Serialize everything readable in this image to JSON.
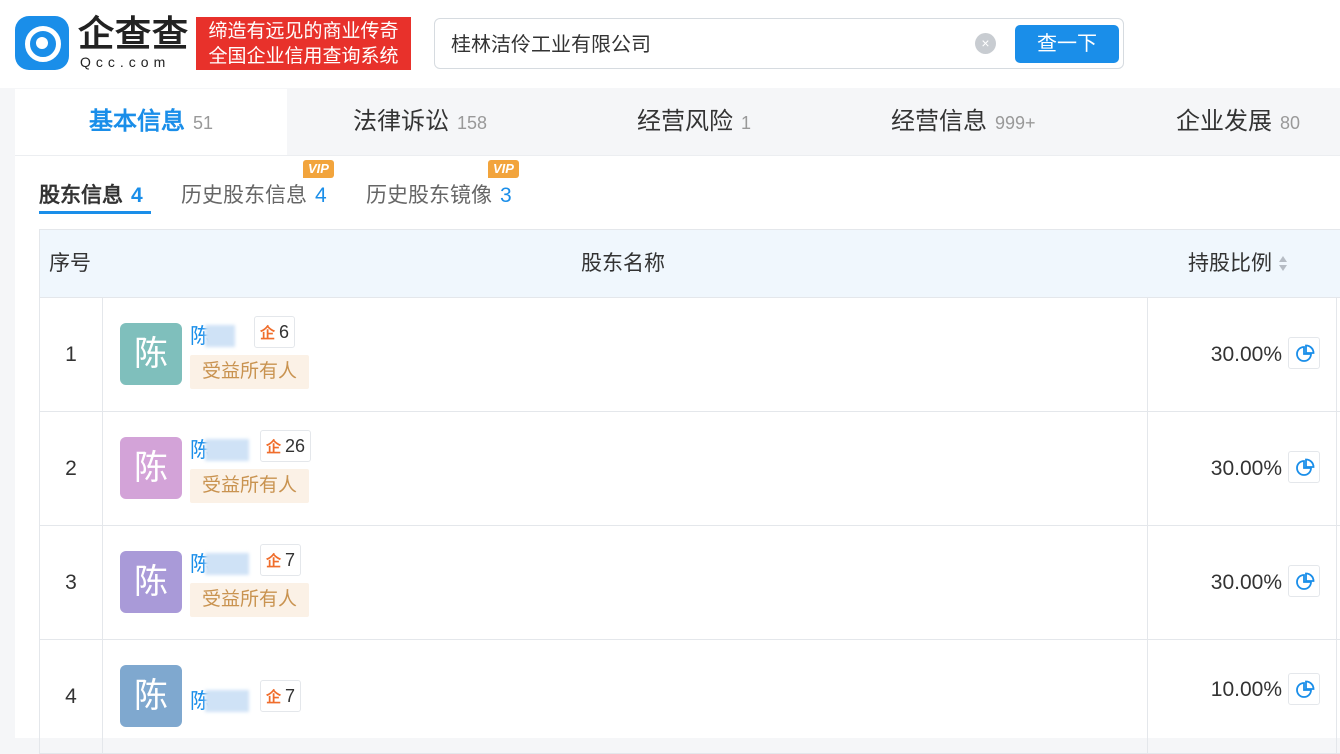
{
  "header": {
    "logo_text": "企查查",
    "logo_sub": "Qcc.com",
    "slogan_line1": "缔造有远见的商业传奇",
    "slogan_line2": "全国企业信用查询系统",
    "search_value": "桂林洁伶工业有限公司",
    "search_button": "查一下",
    "clear_icon": "×"
  },
  "tabs": [
    {
      "label": "基本信息",
      "count": "51",
      "active": true
    },
    {
      "label": "法律诉讼",
      "count": "158"
    },
    {
      "label": "经营风险",
      "count": "1"
    },
    {
      "label": "经营信息",
      "count": "999+"
    },
    {
      "label": "企业发展",
      "count": "80"
    }
  ],
  "subtabs": [
    {
      "label": "股东信息",
      "count": "4",
      "active": true
    },
    {
      "label": "历史股东信息",
      "count": "4",
      "vip": "VIP"
    },
    {
      "label": "历史股东镜像",
      "count": "3",
      "vip": "VIP"
    }
  ],
  "table": {
    "headers": {
      "index": "序号",
      "name": "股东名称",
      "ratio": "持股比例"
    },
    "rows": [
      {
        "index": "1",
        "avatar_char": "陈",
        "avatar_color": "#7fbfbc",
        "name": "陈",
        "graph_icon": "企",
        "graph_count": "6",
        "tag": "受益所有人",
        "ratio": "30.00%"
      },
      {
        "index": "2",
        "avatar_char": "陈",
        "avatar_color": "#d3a3d8",
        "name": "陈",
        "graph_icon": "企",
        "graph_count": "26",
        "tag": "受益所有人",
        "ratio": "30.00%"
      },
      {
        "index": "3",
        "avatar_char": "陈",
        "avatar_color": "#a99ad8",
        "name": "陈",
        "graph_icon": "企",
        "graph_count": "7",
        "tag": "受益所有人",
        "ratio": "30.00%"
      },
      {
        "index": "4",
        "avatar_char": "陈",
        "avatar_color": "#7fa8cf",
        "name": "陈",
        "graph_icon": "企",
        "graph_count": "7",
        "tag": "",
        "ratio": "10.00%"
      }
    ]
  }
}
